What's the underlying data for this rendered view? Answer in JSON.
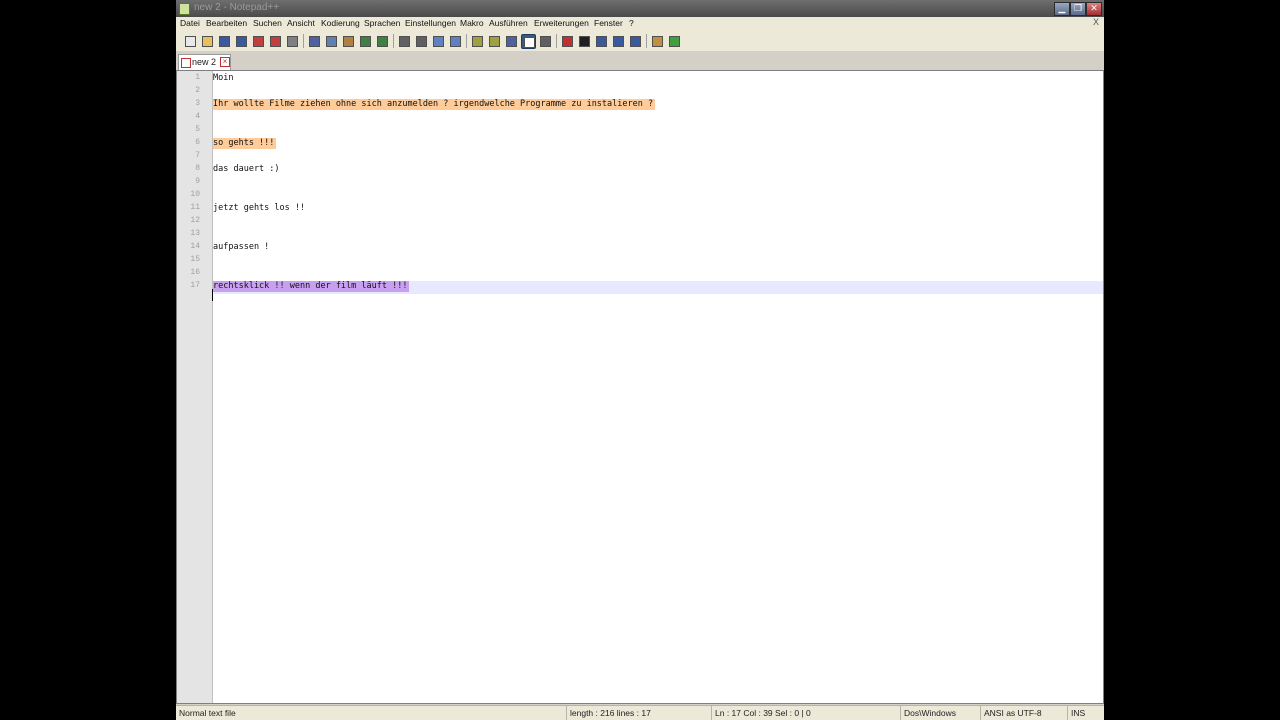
{
  "window": {
    "title": "new 2 - Notepad++",
    "controls": [
      "minimize",
      "restore",
      "close"
    ]
  },
  "menu": {
    "items": [
      "Datei",
      "Bearbeiten",
      "Suchen",
      "Ansicht",
      "Kodierung",
      "Sprachen",
      "Einstellungen",
      "Makro",
      "Ausführen",
      "Erweiterungen",
      "Fenster",
      "?"
    ],
    "close_glyph": "X"
  },
  "toolbar": {
    "buttons": [
      "new-file-icon",
      "open-file-icon",
      "save-icon",
      "save-all-icon",
      "close-icon",
      "close-all-icon",
      "print-icon",
      "cut-icon",
      "copy-icon",
      "paste-icon",
      "undo-icon",
      "redo-icon",
      "find-icon",
      "replace-icon",
      "zoom-in-icon",
      "zoom-out-icon",
      "sync-vertical-icon",
      "sync-horizontal-icon",
      "word-wrap-icon",
      "show-all-chars-icon",
      "indent-guide-icon",
      "record-macro-icon",
      "stop-record-icon",
      "play-macro-icon",
      "run-macro-multiple-icon",
      "save-macro-icon",
      "open-folder-icon",
      "spell-check-icon"
    ],
    "pressed": "show-all-chars-icon"
  },
  "tabs": [
    {
      "label": "new 2",
      "active": true
    }
  ],
  "editor": {
    "line_numbers": [
      "1",
      "2",
      "3",
      "4",
      "5",
      "6",
      "7",
      "8",
      "9",
      "10",
      "11",
      "12",
      "13",
      "14",
      "15",
      "16",
      "17"
    ],
    "lines": [
      {
        "text": "Moin",
        "highlight": ""
      },
      {
        "text": "",
        "highlight": ""
      },
      {
        "text": "Ihr wollte Filme ziehen ohne sich anzumelden ? irgendwelche Programme zu instalieren ?",
        "highlight": "orange"
      },
      {
        "text": "",
        "highlight": ""
      },
      {
        "text": "",
        "highlight": ""
      },
      {
        "text": "so gehts !!!",
        "highlight": "orange"
      },
      {
        "text": "",
        "highlight": ""
      },
      {
        "text": "das dauert :)",
        "highlight": ""
      },
      {
        "text": "",
        "highlight": ""
      },
      {
        "text": "",
        "highlight": ""
      },
      {
        "text": "jetzt gehts los !!",
        "highlight": ""
      },
      {
        "text": "",
        "highlight": ""
      },
      {
        "text": "",
        "highlight": ""
      },
      {
        "text": "aufpassen !",
        "highlight": ""
      },
      {
        "text": "",
        "highlight": ""
      },
      {
        "text": "",
        "highlight": ""
      },
      {
        "text": "rechtsklick !! wenn der film läuft !!!",
        "highlight": "purple"
      }
    ],
    "colors": {
      "orange_highlight": "#ffcc99",
      "purple_highlight": "#c8a0f0",
      "current_line": "#e8e8ff"
    }
  },
  "status": {
    "file_type": "Normal text file",
    "length": "length : 216    lines : 17",
    "position": "Ln : 17    Col : 39    Sel : 0 | 0",
    "eol": "Dos\\Windows",
    "encoding": "ANSI as UTF-8",
    "mode": "INS"
  }
}
